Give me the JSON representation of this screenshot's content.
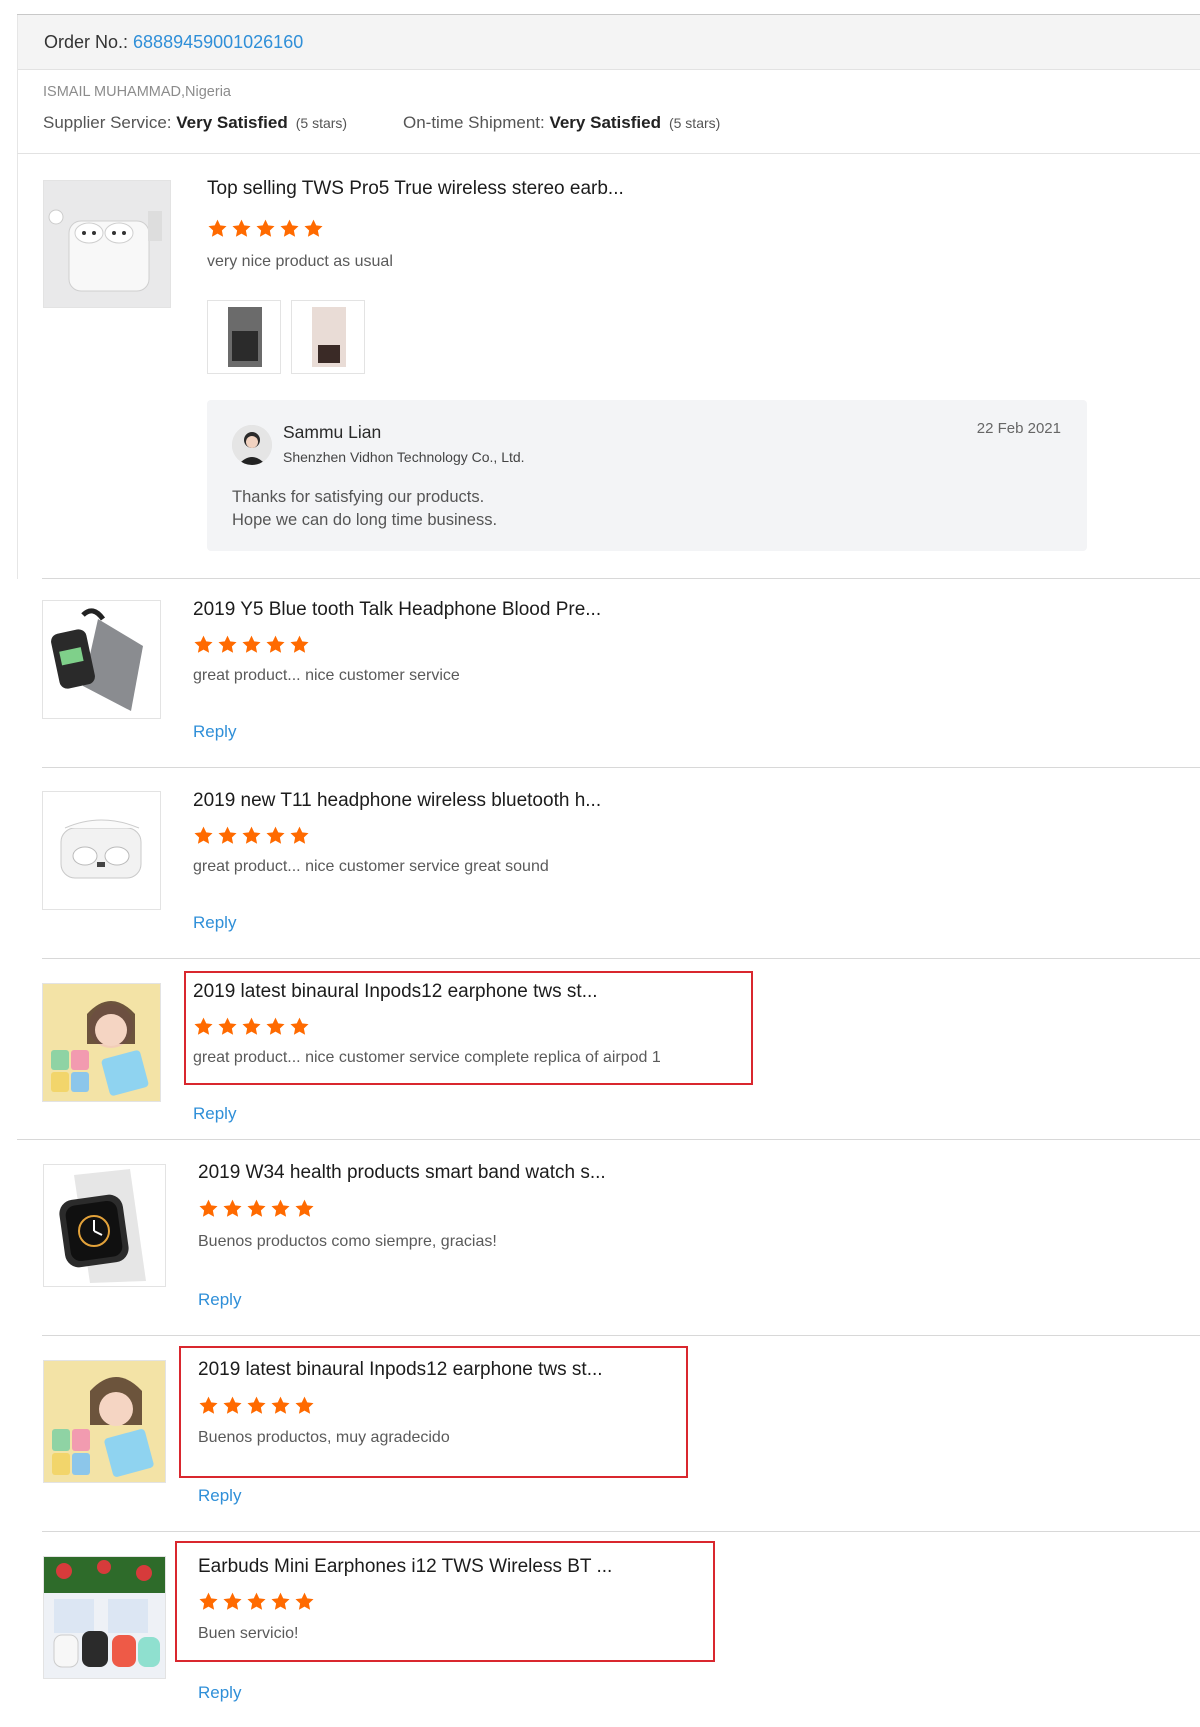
{
  "order": {
    "label": "Order No.: ",
    "number": "68889459001026160"
  },
  "buyer": "ISMAIL MUHAMMAD,Nigeria",
  "ratings": {
    "supplier_label": "Supplier Service: ",
    "supplier_value": "Very Satisfied",
    "supplier_stars": "(5 stars)",
    "shipment_label": "On-time Shipment: ",
    "shipment_value": "Very Satisfied",
    "shipment_stars": "(5 stars)"
  },
  "first_review": {
    "title": "Top selling TWS Pro5 True wireless stereo earb...",
    "rating": 5,
    "comment": "very nice product as usual",
    "reply": {
      "name": "Sammu Lian",
      "company": "Shenzhen Vidhon Technology Co., Ltd.",
      "date": "22 Feb 2021",
      "message": "Thanks for satisfying our products.\nHope we can do long time business."
    }
  },
  "reviews": [
    {
      "title": "2019 Y5 Blue tooth Talk Headphone Blood Pre...",
      "rating": 5,
      "comment": "great product... nice customer service",
      "reply_label": "Reply"
    },
    {
      "title": "2019 new T11 headphone wireless bluetooth h...",
      "rating": 5,
      "comment": "great product... nice customer service great sound",
      "reply_label": "Reply"
    },
    {
      "title": "2019 latest binaural Inpods12 earphone tws st...",
      "rating": 5,
      "comment": "great product... nice customer service  complete replica of airpod 1",
      "reply_label": "Reply"
    },
    {
      "title": "2019 W34 health products smart band watch s...",
      "rating": 5,
      "comment": "Buenos productos como siempre, gracias!",
      "reply_label": "Reply"
    },
    {
      "title": "2019 latest binaural Inpods12 earphone tws st...",
      "rating": 5,
      "comment": "Buenos productos, muy agradecido",
      "reply_label": "Reply"
    },
    {
      "title": "Earbuds Mini Earphones i12 TWS Wireless BT ...",
      "rating": 5,
      "comment": "Buen servicio!",
      "reply_label": "Reply"
    }
  ],
  "colors": {
    "accent": "#2f8fd8",
    "star": "#ff6a00",
    "highlight": "#d9272e"
  }
}
